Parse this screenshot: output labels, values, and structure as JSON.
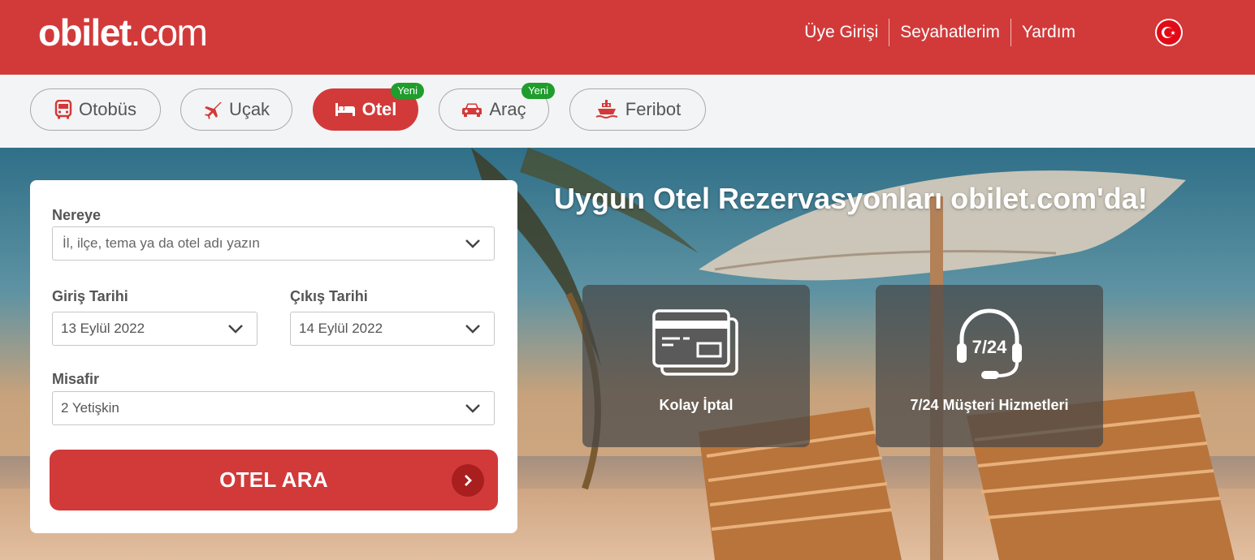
{
  "logo": {
    "bold": "obilet",
    "rest": ".com"
  },
  "header": {
    "nav": [
      "Üye Girişi",
      "Seyahatlerim",
      "Yardım"
    ],
    "flag": "turkey-flag-icon"
  },
  "tabs": [
    {
      "label": "Otobüs",
      "icon": "bus-icon",
      "active": false
    },
    {
      "label": "Uçak",
      "icon": "plane-icon",
      "active": false
    },
    {
      "label": "Otel",
      "icon": "bed-icon",
      "active": true,
      "badge": "Yeni"
    },
    {
      "label": "Araç",
      "icon": "car-icon",
      "active": false,
      "badge": "Yeni"
    },
    {
      "label": "Feribot",
      "icon": "ferry-icon",
      "active": false
    }
  ],
  "form": {
    "destination": {
      "label": "Nereye",
      "placeholder": "İl, ilçe, tema ya da otel adı yazın"
    },
    "checkin": {
      "label": "Giriş Tarihi",
      "value": "13 Eylül 2022"
    },
    "checkout": {
      "label": "Çıkış Tarihi",
      "value": "14 Eylül 2022"
    },
    "guests": {
      "label": "Misafir",
      "value": "2 Yetişkin"
    },
    "search_label": "OTEL ARA"
  },
  "hero": {
    "headline": "Uygun Otel Rezervasyonları obilet.com'da!",
    "features": [
      {
        "label": "Kolay İptal",
        "icon": "credit-card-icon"
      },
      {
        "label": "7/24 Müşteri Hizmetleri",
        "icon": "headset-icon",
        "icon_text": "7/24"
      }
    ]
  },
  "colors": {
    "brand": "#d23a3a",
    "badge": "#1f9d2d",
    "tabbar": "#f3f4f5"
  }
}
